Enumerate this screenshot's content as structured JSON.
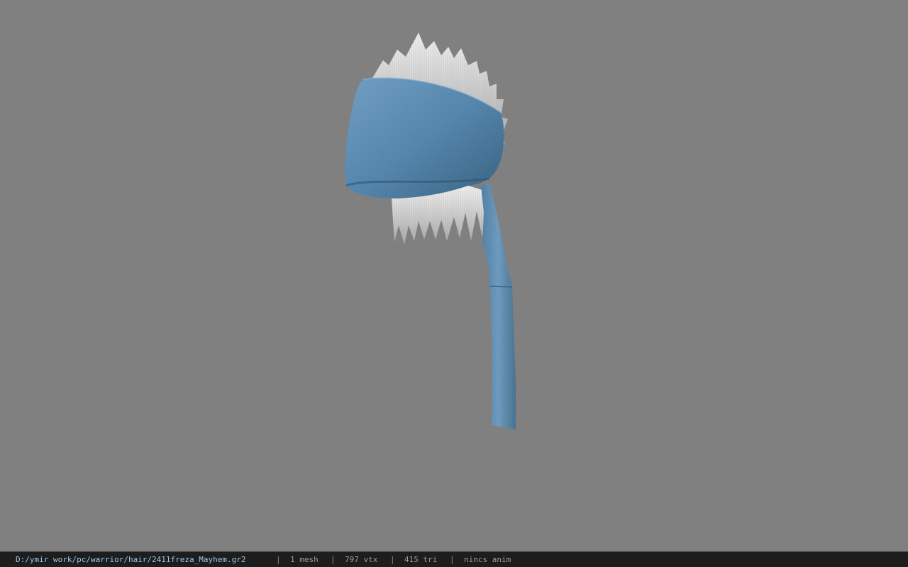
{
  "viewer": {
    "background_color": "#808080",
    "model": {
      "bandana_color": "#4f7fa6",
      "hair_color": "#d9d9d9"
    }
  },
  "status_bar": {
    "file_path": "D:/ymir work/pc/warrior/hair/2411freza_Mayhem.gr2",
    "separator": "|",
    "mesh_count": "1 mesh",
    "vertex_count": "797 vtx",
    "triangle_count": "415 tri",
    "anim_status": "nincs anim"
  }
}
